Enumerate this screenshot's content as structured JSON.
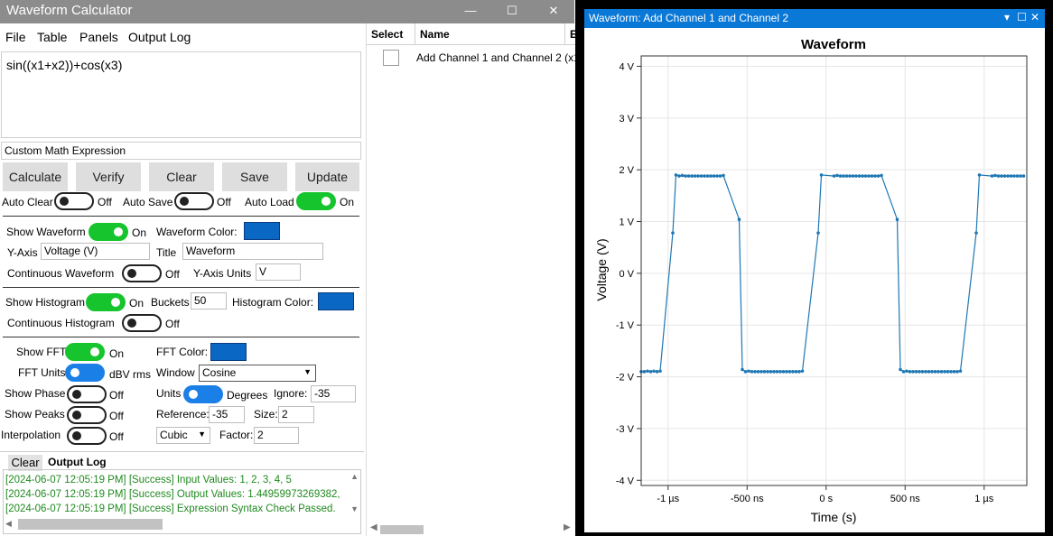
{
  "app": {
    "title": "Waveform Calculator",
    "window_buttons": {
      "minimize": "—",
      "maximize": "☐",
      "close": "✕"
    }
  },
  "menu": [
    "File",
    "Table",
    "Panels",
    "Output Log"
  ],
  "expression": {
    "value": "sin((x1+x2))+cos(x3)",
    "name": "Custom Math Expression"
  },
  "buttons": [
    "Calculate",
    "Verify",
    "Clear",
    "Save",
    "Update"
  ],
  "auto": {
    "clear": {
      "label": "Auto Clear",
      "state": "Off"
    },
    "save": {
      "label": "Auto Save",
      "state": "Off"
    },
    "load": {
      "label": "Auto Load",
      "state": "On"
    }
  },
  "waveform_settings": {
    "show_label": "Show Waveform",
    "show_state": "On",
    "color_label": "Waveform Color:",
    "color": "#0a68c4",
    "yaxis_label": "Y-Axis",
    "yaxis_value": "Voltage (V)",
    "title_label": "Title",
    "title_value": "Waveform",
    "continuous_label": "Continuous Waveform",
    "continuous_state": "Off",
    "units_label": "Y-Axis Units",
    "units_value": "V"
  },
  "histogram_settings": {
    "show_label": "Show Histogram",
    "show_state": "On",
    "buckets_label": "Buckets",
    "buckets_value": "50",
    "color_label": "Histogram Color:",
    "color": "#0a68c4",
    "continuous_label": "Continuous Histogram",
    "continuous_state": "Off"
  },
  "fft_settings": {
    "show_label": "Show FFT",
    "show_state": "On",
    "color_label": "FFT Color:",
    "color": "#0a68c4",
    "units_label": "FFT Units",
    "units_state": "dBV rms",
    "window_label": "Window",
    "window_value": "Cosine",
    "phase_label": "Show Phase",
    "phase_state": "Off",
    "phase_units_label": "Units",
    "phase_units_state": "Degrees",
    "ignore_label": "Ignore:",
    "ignore_value": "-35",
    "peaks_label": "Show Peaks",
    "peaks_state": "Off",
    "reference_label": "Reference:",
    "reference_value": "-35",
    "size_label": "Size:",
    "size_value": "2",
    "interp_label": "Interpolation",
    "interp_state": "Off",
    "interp_value": "Cubic",
    "factor_label": "Factor:",
    "factor_value": "2"
  },
  "output_log": {
    "clear_label": "Clear",
    "tab_label": "Output Log",
    "lines": [
      "[2024-06-07 12:05:19 PM] [Success] Input Values: 1, 2, 3, 4, 5",
      "[2024-06-07 12:05:19 PM] [Success] Output Values: 1.44959973269382,",
      "[2024-06-07 12:05:19 PM] [Success] Expression Syntax Check Passed."
    ]
  },
  "table": {
    "headers": [
      "Select",
      "Name",
      "E"
    ],
    "rows": [
      {
        "name": "Add Channel 1 and Channel 2 (x1"
      }
    ]
  },
  "waveform_window": {
    "title": "Waveform: Add Channel 1 and Channel 2",
    "buttons": {
      "pin": "▾",
      "maximize": "☐",
      "close": "✕"
    }
  },
  "chart_data": {
    "type": "line",
    "title": "Waveform",
    "xlabel": "Time (s)",
    "ylabel": "Voltage (V)",
    "xlim": [
      -1.17e-06,
      1.27e-06
    ],
    "ylim": [
      -4.1,
      4.2
    ],
    "y_ticks": [
      4,
      3,
      2,
      1,
      0,
      -1,
      -2,
      -3,
      -4
    ],
    "y_tick_labels": [
      "4 V",
      "3 V",
      "2 V",
      "1 V",
      "0 V",
      "-1 V",
      "-2 V",
      "-3 V",
      "-4 V"
    ],
    "x_ticks": [
      -1e-06,
      -5e-07,
      0,
      5e-07,
      1e-06
    ],
    "x_tick_labels": [
      "-1 µs",
      "-500 ns",
      "0 s",
      "500 ns",
      "1 µs"
    ],
    "grid": true,
    "color": "#1f77b4",
    "series": [
      {
        "x": [
          -1.17e-06,
          -1.15e-06,
          -1.13e-06,
          -1.11e-06,
          -1.09e-06,
          -1.07e-06,
          -1.05e-06,
          -9.7e-07,
          -9.5e-07,
          -9.3e-07,
          -9.1e-07,
          -8.9e-07,
          -8.7e-07,
          -8.5e-07,
          -8.3e-07,
          -8.1e-07,
          -7.9e-07,
          -7.7e-07,
          -7.5e-07,
          -7.3e-07,
          -7.1e-07,
          -6.9e-07,
          -6.7e-07,
          -6.5e-07,
          -5.5e-07,
          -5.3e-07,
          -5.1e-07,
          -4.9e-07,
          -4.7e-07,
          -4.5e-07,
          -4.3e-07,
          -4.1e-07,
          -3.9e-07,
          -3.7e-07,
          -3.5e-07,
          -3.3e-07,
          -3.1e-07,
          -2.9e-07,
          -2.7e-07,
          -2.5e-07,
          -2.3e-07,
          -2.1e-07,
          -1.9e-07,
          -1.7e-07,
          -1.5e-07,
          -5e-08,
          -3e-08,
          5e-08,
          7e-08,
          9e-08,
          1.1e-07,
          1.3e-07,
          1.5e-07,
          1.7e-07,
          1.9e-07,
          2.1e-07,
          2.3e-07,
          2.5e-07,
          2.7e-07,
          2.9e-07,
          3.1e-07,
          3.3e-07,
          3.5e-07,
          4.5e-07,
          4.7e-07,
          4.9e-07,
          5.1e-07,
          5.3e-07,
          5.5e-07,
          5.7e-07,
          5.9e-07,
          6.1e-07,
          6.3e-07,
          6.5e-07,
          6.7e-07,
          6.9e-07,
          7.1e-07,
          7.3e-07,
          7.5e-07,
          7.7e-07,
          7.9e-07,
          8.1e-07,
          8.3e-07,
          8.5e-07,
          9.5e-07,
          9.7e-07,
          1.05e-06,
          1.07e-06,
          1.09e-06,
          1.11e-06,
          1.13e-06,
          1.15e-06,
          1.17e-06,
          1.19e-06,
          1.21e-06,
          1.23e-06,
          1.25e-06
        ],
        "y": [
          -1.9,
          -1.9,
          -1.89,
          -1.9,
          -1.89,
          -1.9,
          -1.89,
          0.78,
          1.9,
          1.88,
          1.89,
          1.88,
          1.88,
          1.88,
          1.88,
          1.88,
          1.88,
          1.88,
          1.88,
          1.88,
          1.88,
          1.88,
          1.88,
          1.89,
          1.04,
          -1.86,
          -1.9,
          -1.89,
          -1.9,
          -1.9,
          -1.9,
          -1.9,
          -1.9,
          -1.9,
          -1.9,
          -1.9,
          -1.9,
          -1.9,
          -1.9,
          -1.9,
          -1.9,
          -1.9,
          -1.9,
          -1.9,
          -1.89,
          0.78,
          1.9,
          1.88,
          1.89,
          1.88,
          1.88,
          1.88,
          1.88,
          1.88,
          1.88,
          1.88,
          1.88,
          1.88,
          1.88,
          1.88,
          1.88,
          1.88,
          1.89,
          1.04,
          -1.86,
          -1.9,
          -1.89,
          -1.9,
          -1.9,
          -1.9,
          -1.9,
          -1.9,
          -1.9,
          -1.9,
          -1.9,
          -1.9,
          -1.9,
          -1.9,
          -1.9,
          -1.9,
          -1.9,
          -1.9,
          -1.9,
          -1.89,
          0.78,
          1.9,
          1.88,
          1.89,
          1.88,
          1.88,
          1.88,
          1.88,
          1.88,
          1.88,
          1.88,
          1.88,
          1.88
        ]
      }
    ]
  }
}
